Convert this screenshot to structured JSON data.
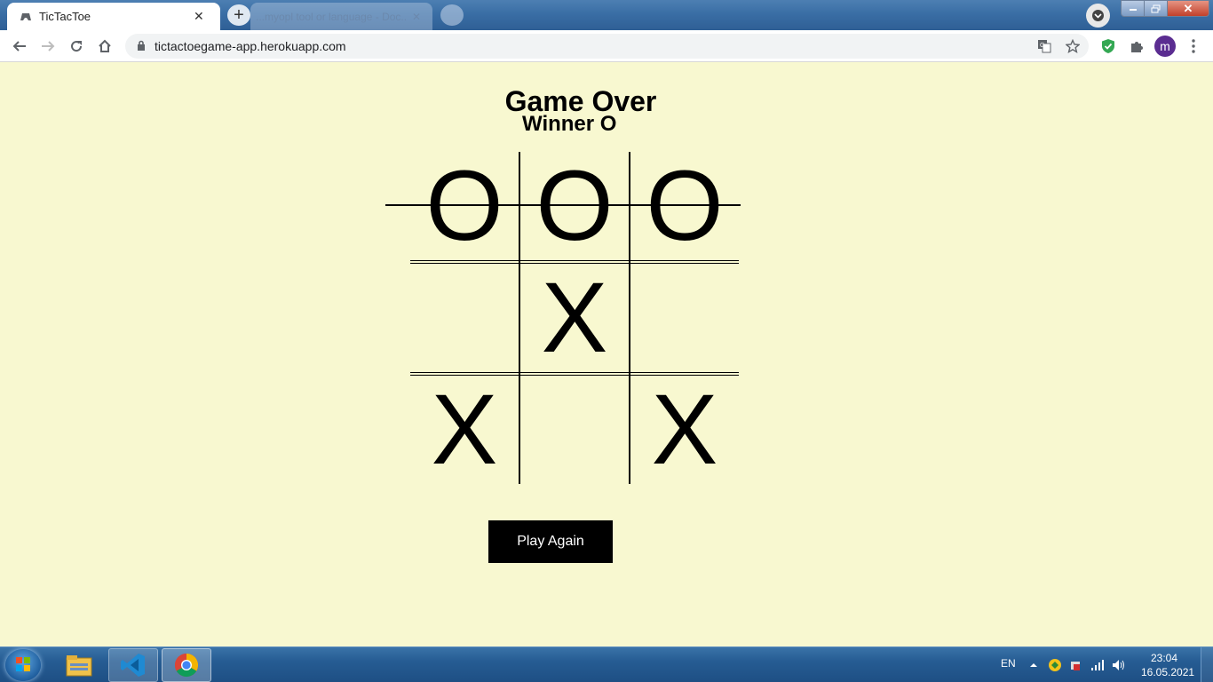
{
  "browser": {
    "tabs": [
      {
        "title": "TicTacToe",
        "active": true
      },
      {
        "title": "...myopl tool or language - Doc...",
        "active": false
      }
    ],
    "url": "tictactoegame-app.herokuapp.com",
    "profile_initial": "m"
  },
  "game": {
    "heading": "Game Over",
    "winner_text": "Winner O",
    "board": [
      [
        "O",
        "O",
        "O"
      ],
      [
        "",
        "X",
        ""
      ],
      [
        "X",
        "",
        "X"
      ]
    ],
    "winning_line": "row-1",
    "play_again_label": "Play Again"
  },
  "taskbar": {
    "language": "EN",
    "time": "23:04",
    "date": "16.05.2021"
  },
  "colors": {
    "page_background": "#f8f8d0",
    "button_background": "#000000",
    "button_text": "#ffffff"
  }
}
